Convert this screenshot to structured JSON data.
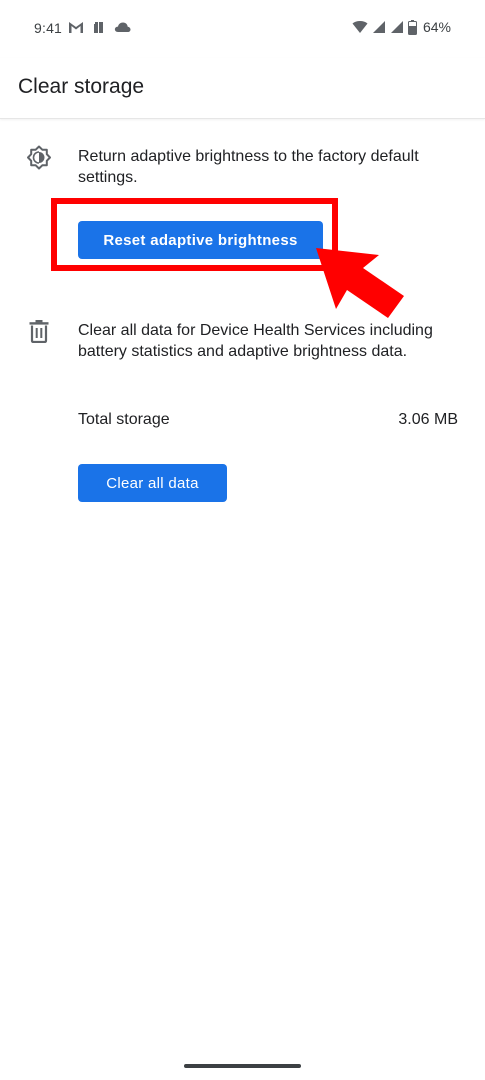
{
  "status_bar": {
    "time": "9:41",
    "battery_percent": "64%",
    "left_icons": [
      "gmail-icon",
      "notification-app-icon",
      "cloud-icon"
    ],
    "right_icons": [
      "wifi-icon",
      "signal-icon",
      "signal-icon",
      "battery-icon"
    ]
  },
  "app_bar": {
    "title": "Clear storage"
  },
  "brightness_section": {
    "icon": "adaptive-brightness-icon",
    "description": "Return adaptive brightness to the factory default settings.",
    "button_label": "Reset adaptive brightness"
  },
  "data_section": {
    "icon": "trash-icon",
    "description": "Clear all data for Device Health Services including battery statistics and adaptive brightness data.",
    "storage_label": "Total storage",
    "storage_value": "3.06 MB",
    "button_label": "Clear all data"
  },
  "colors": {
    "accent": "#1a73e8",
    "annotation": "#ff0000",
    "text": "#202124"
  }
}
